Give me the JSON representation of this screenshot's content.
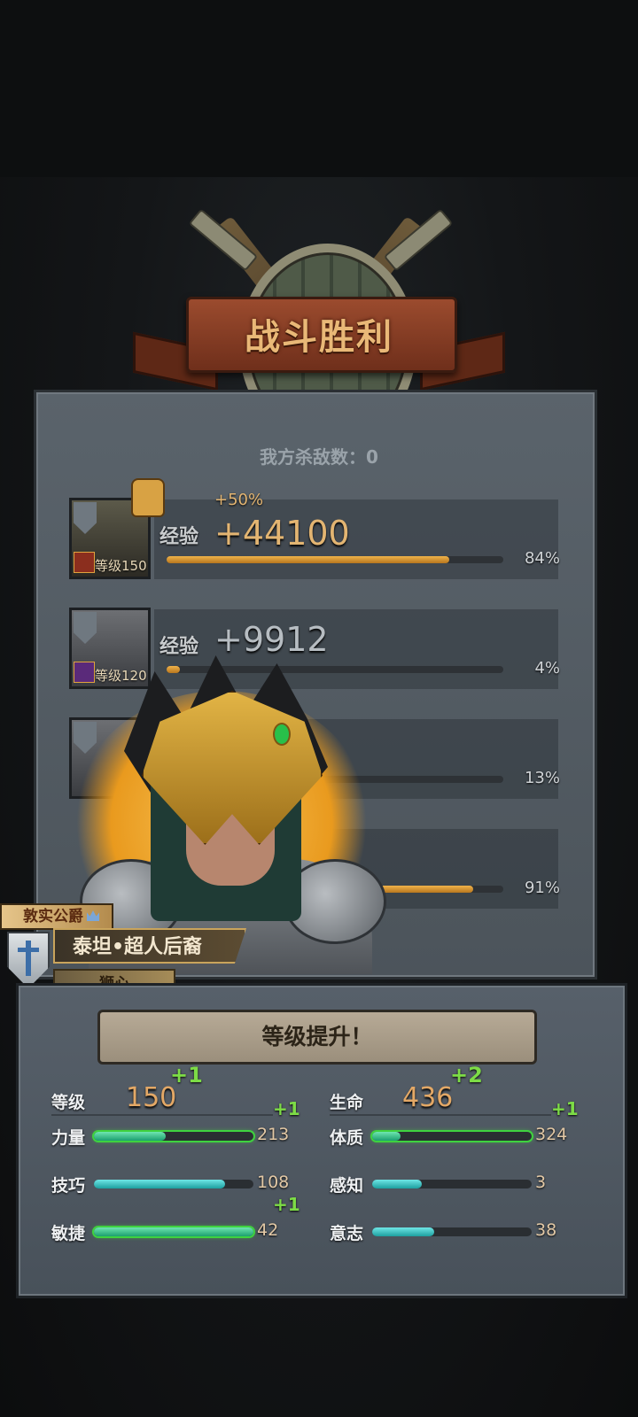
{
  "banner": {
    "title": "战斗胜利"
  },
  "kills": {
    "text": "我方杀敌数：0"
  },
  "heroes": [
    {
      "exp_label": "经验",
      "exp_value": "+44100",
      "bonus": "+50%",
      "level": "等级150",
      "progress": 0.84,
      "pct": "84%"
    },
    {
      "exp_label": "经验",
      "exp_value": "+9912",
      "level": "等级120",
      "progress": 0.04,
      "pct": "4%"
    },
    {
      "progress": 0.13,
      "pct": "13%"
    },
    {
      "progress": 0.91,
      "pct": "91%"
    }
  ],
  "hero_info": {
    "title_badge": "敦实公爵",
    "name": "泰坦•超人后裔",
    "sub": "狮心"
  },
  "levelup": {
    "title": "等级提升！",
    "level": {
      "label": "等级",
      "value": "150",
      "plus": "+1"
    },
    "hp": {
      "label": "生命",
      "value": "436",
      "plus": "+2"
    },
    "stats": [
      {
        "label": "力量",
        "value": "213",
        "plus": "+1",
        "fill": 0.45,
        "highlight": true
      },
      {
        "label": "体质",
        "value": "324",
        "plus": "+1",
        "fill": 0.18,
        "highlight": true
      },
      {
        "label": "技巧",
        "value": "108",
        "plus": "",
        "fill": 0.82,
        "highlight": false
      },
      {
        "label": "感知",
        "value": "3",
        "plus": "",
        "fill": 0.31,
        "highlight": false
      },
      {
        "label": "敏捷",
        "value": "42",
        "plus": "+1",
        "fill": 1.0,
        "highlight": true
      },
      {
        "label": "意志",
        "value": "38",
        "plus": "",
        "fill": 0.39,
        "highlight": false
      }
    ]
  }
}
